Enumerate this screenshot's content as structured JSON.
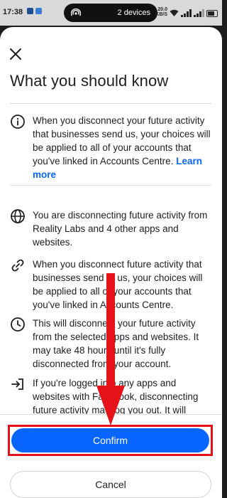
{
  "status_bar": {
    "time": "17:38",
    "devices": "2 devices",
    "speed_value": "20.0",
    "speed_unit": "KB/S"
  },
  "sheet": {
    "title": "What you should know",
    "info": {
      "text": "When you disconnect your future activity that businesses send us, your choices will be applied to all of your accounts that you've linked in Accounts Centre.",
      "link": "Learn more"
    },
    "items": [
      {
        "icon": "globe-icon",
        "text": "You are disconnecting future activity from Reality Labs and 4 other apps and websites."
      },
      {
        "icon": "link-icon",
        "text": "When you disconnect future activity that businesses send to us, your choices will be applied to all of your accounts that you've linked in Accounts Centre."
      },
      {
        "icon": "clock-icon",
        "text": "This will disconnect your future activity from the selected apps and websites. It may take 48 hours until it's fully disconnected from your account."
      },
      {
        "icon": "logout-icon",
        "text": "If you're logged into any apps and websites with Facebook, disconnecting future activity may log you out. It will"
      }
    ]
  },
  "footer": {
    "confirm_label": "Confirm",
    "cancel_label": "Cancel"
  },
  "colors": {
    "accent": "#0866ff",
    "annotation_red": "#e6121a"
  }
}
